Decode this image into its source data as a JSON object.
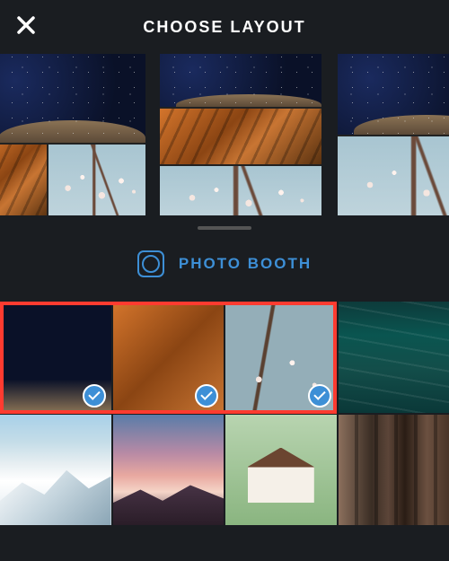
{
  "header": {
    "title": "CHOOSE LAYOUT",
    "close_icon": "close"
  },
  "layouts": [
    {
      "id": "layout-2x2-a",
      "panels": [
        "stars",
        "canyon",
        "blossoms"
      ]
    },
    {
      "id": "layout-3row",
      "panels": [
        "stars",
        "canyon",
        "blossoms"
      ]
    },
    {
      "id": "layout-2row",
      "panels": [
        "stars",
        "blossoms"
      ]
    }
  ],
  "photo_booth": {
    "label": "PHOTO BOOTH",
    "icon": "camera"
  },
  "gallery_thumbnails": [
    {
      "id": "stars",
      "selected": true
    },
    {
      "id": "canyon",
      "selected": true
    },
    {
      "id": "blossoms",
      "selected": true
    },
    {
      "id": "ocean",
      "selected": false
    },
    {
      "id": "snow-mountain",
      "selected": false
    },
    {
      "id": "pink-ridge",
      "selected": false
    },
    {
      "id": "house-alpine",
      "selected": false
    },
    {
      "id": "rock-cliff",
      "selected": false
    }
  ],
  "selection_highlight": {
    "covers_thumbnail_indices": [
      0,
      1,
      2
    ],
    "color": "#ff3b30"
  },
  "colors": {
    "accent": "#3d8fd6",
    "background": "#1a1d21",
    "highlight": "#ff3b30"
  }
}
